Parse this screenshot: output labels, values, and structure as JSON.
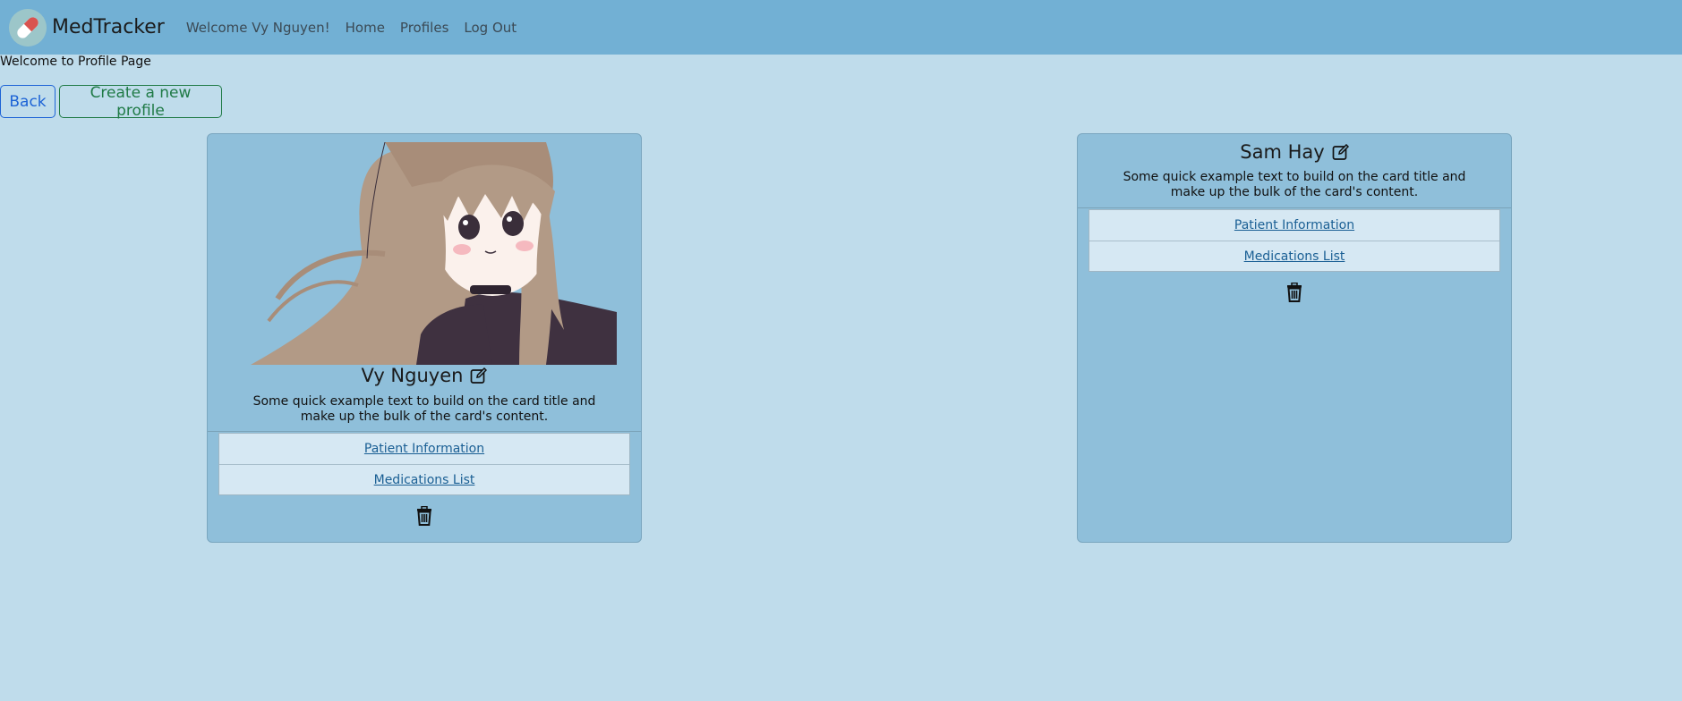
{
  "navbar": {
    "brand": "MedTracker",
    "welcome": "Welcome Vy Nguyen!",
    "links": [
      "Home",
      "Profiles",
      "Log Out"
    ]
  },
  "page": {
    "welcome": "Welcome to Profile Page",
    "back_label": "Back",
    "create_label": "Create a new profile"
  },
  "profiles": [
    {
      "name": "Vy Nguyen",
      "text": "Some quick example text to build on the card title and make up the bulk of the card's content.",
      "links": [
        "Patient Information",
        "Medications List"
      ]
    },
    {
      "name": "Sam Hay",
      "text": "Some quick example text to build on the card title and make up the bulk of the card's content.",
      "links": [
        "Patient Information",
        "Medications List"
      ]
    }
  ],
  "colors": {
    "background": "#bfdceb",
    "navbar": "#72b0d4",
    "card": "#8fbfda",
    "back_button": "#1d63d6",
    "create_button": "#1f7a46",
    "link": "#1a5f94"
  },
  "icons": {
    "brand": "pill-icon",
    "edit": "edit-icon",
    "delete": "trash-icon"
  }
}
